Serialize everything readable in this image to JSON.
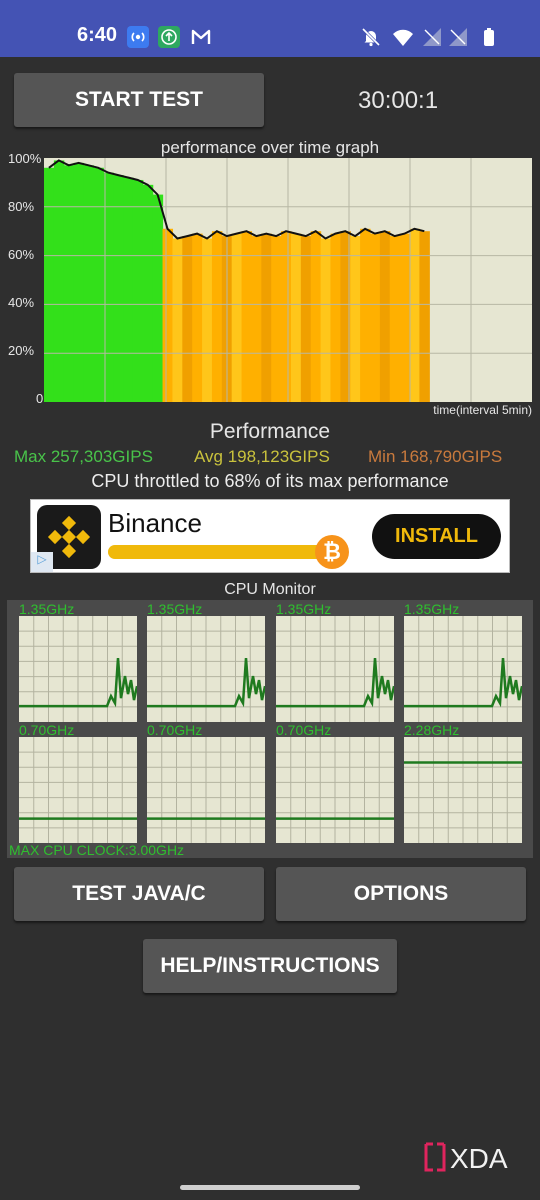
{
  "status_bar": {
    "time": "6:40",
    "icons": [
      "hotspot-icon",
      "upload-icon",
      "gmail-icon",
      "mute-icon",
      "wifi-icon",
      "signal-icon",
      "signal-icon-2",
      "battery-icon"
    ]
  },
  "toolbar": {
    "start_label": "START TEST",
    "timer": "30:00:1"
  },
  "graph": {
    "title": "performance over time graph",
    "y_ticks": [
      "100%",
      "80%",
      "60%",
      "40%",
      "20%",
      "0"
    ],
    "x_label": "time(interval 5min)"
  },
  "chart_data": {
    "type": "area",
    "title": "performance over time graph",
    "xlabel": "time(interval 5min)",
    "ylabel": "",
    "ylim": [
      0,
      100
    ],
    "xlim": [
      0,
      38
    ],
    "grid": true,
    "x": [
      0,
      1,
      2,
      3,
      4,
      5,
      6,
      7,
      8,
      9,
      10,
      11,
      12,
      13,
      14,
      15,
      16,
      17,
      18,
      19,
      20,
      21,
      22,
      23,
      24,
      25,
      26,
      27,
      28,
      29,
      30,
      31,
      32,
      33,
      34,
      35,
      36,
      37,
      38
    ],
    "series": [
      {
        "values": [
          96,
          99,
          97,
          98,
          97,
          96,
          94,
          93,
          92,
          91,
          89,
          85,
          71,
          67,
          68,
          69,
          67,
          70,
          68,
          69,
          70,
          68,
          69,
          68,
          70,
          69,
          68,
          70,
          67,
          69,
          70,
          68,
          71,
          69,
          70,
          68,
          69,
          71,
          70
        ]
      }
    ],
    "colors": {
      "high": "#33e01a",
      "mid": "#c8e020",
      "low": "#ffb000",
      "line": "#111111"
    }
  },
  "performance": {
    "title": "Performance",
    "max": "Max 257,303GIPS",
    "avg": "Avg 198,123GIPS",
    "min": "Min 168,790GIPS",
    "throttled": "CPU throttled to 68% of its max performance",
    "colors": {
      "max": "#49c34a",
      "avg": "#c9c23d",
      "min": "#c97a3d"
    }
  },
  "ad": {
    "name": "Binance",
    "install": "INSTALL",
    "progress": 0.95
  },
  "cpu_monitor": {
    "title": "CPU Monitor",
    "max_clock": "MAX CPU CLOCK:3.00GHz",
    "cores": [
      {
        "label": "1.35GHz",
        "level": 0.15,
        "spike": true
      },
      {
        "label": "1.35GHz",
        "level": 0.15,
        "spike": true
      },
      {
        "label": "1.35GHz",
        "level": 0.15,
        "spike": true
      },
      {
        "label": "1.35GHz",
        "level": 0.15,
        "spike": true
      },
      {
        "label": "0.70GHz",
        "level": 0.23,
        "spike": false
      },
      {
        "label": "0.70GHz",
        "level": 0.23,
        "spike": false
      },
      {
        "label": "0.70GHz",
        "level": 0.23,
        "spike": false
      },
      {
        "label": "2.28GHz",
        "level": 0.76,
        "spike": false
      }
    ]
  },
  "buttons": {
    "test_java": "TEST JAVA/C",
    "options": "OPTIONS",
    "help": "HELP/INSTRUCTIONS"
  },
  "watermark": "XDA"
}
